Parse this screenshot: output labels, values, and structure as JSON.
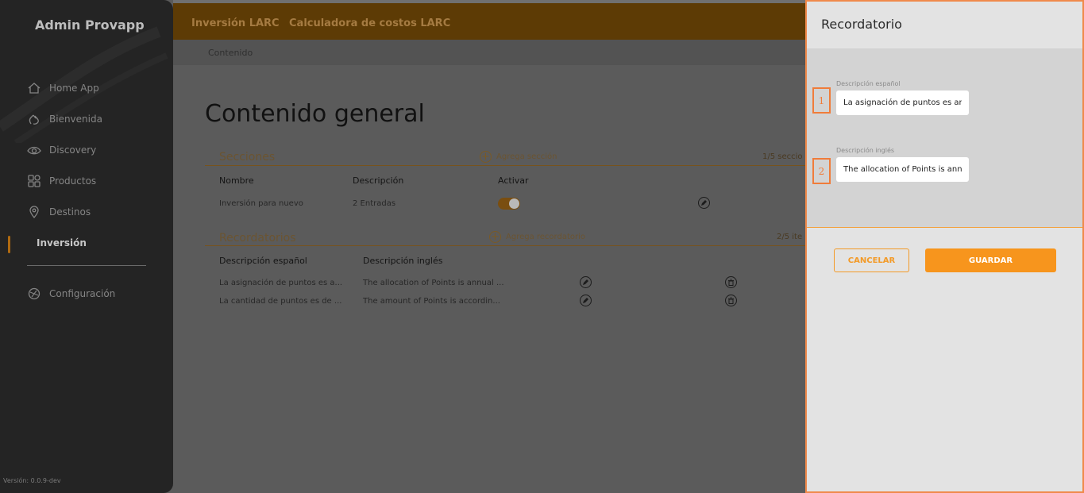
{
  "app": {
    "title": "Admin Provapp",
    "version": "Versión: 0.0.9-dev"
  },
  "sidebar": {
    "items": [
      {
        "label": "Home App",
        "icon": "home-icon"
      },
      {
        "label": "Bienvenida",
        "icon": "wave-hand-icon"
      },
      {
        "label": "Discovery",
        "icon": "eye-icon"
      },
      {
        "label": "Productos",
        "icon": "grid-icon"
      },
      {
        "label": "Destinos",
        "icon": "location-pin-icon"
      },
      {
        "label": "Inversión",
        "icon": "",
        "active": true
      },
      {
        "label": "Configuración",
        "icon": "settings-icon"
      }
    ]
  },
  "tabs": [
    {
      "label": "Inversión LARC",
      "active": true
    },
    {
      "label": "Calculadora de costos LARC"
    }
  ],
  "breadcrumb": "Contenido",
  "main": {
    "title": "Contenido general",
    "secciones": {
      "heading": "Secciones",
      "add_label": "Agrega sección",
      "count": "1/5 seccio",
      "columns": [
        "Nombre",
        "Descripción",
        "Activar"
      ],
      "rows": [
        {
          "nombre": "Inversión para nuevo",
          "descripcion": "2 Entradas",
          "activo": true
        }
      ]
    },
    "recordatorios": {
      "heading": "Recordatorios",
      "add_label": "Agrega recordatorio",
      "count": "2/5 ite",
      "columns": [
        "Descripción español",
        "Descripción inglés"
      ],
      "rows": [
        {
          "es": "La asignación de puntos es a...",
          "en": "The allocation of Points is annual ..."
        },
        {
          "es": "La cantidad de puntos es de ...",
          "en": "The amount of Points is accordin..."
        }
      ]
    }
  },
  "drawer": {
    "title": "Recordatorio",
    "fields": [
      {
        "marker": "1",
        "label": "Descripción español",
        "value": "La asignación de puntos es an"
      },
      {
        "marker": "2",
        "label": "Descripción inglés",
        "value": "The allocation of Points is annu"
      }
    ],
    "cancel_label": "CANCELAR",
    "save_label": "GUARDAR"
  },
  "colors": {
    "accent": "#f7951d",
    "marker": "#f07c3a",
    "sidebar": "#242424"
  }
}
